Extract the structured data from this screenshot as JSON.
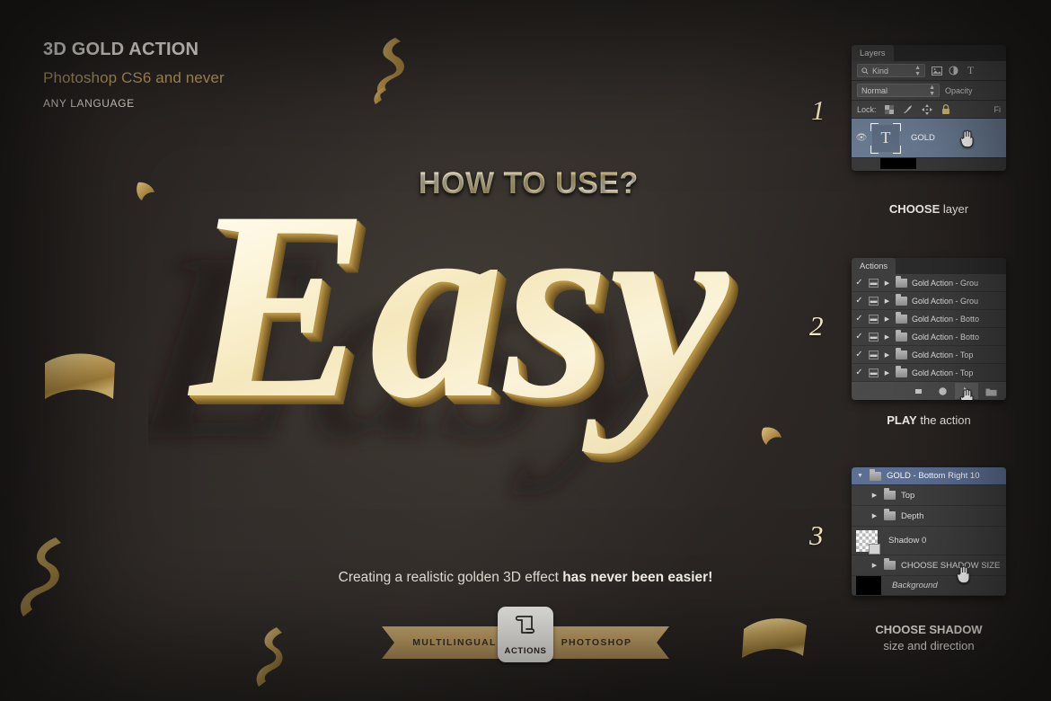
{
  "meta": {
    "background_color": "#2b2724",
    "gold_color": "#c4a469",
    "cream_color": "#f6ecc6"
  },
  "header": {
    "title": "3D GOLD ACTION",
    "subtitle": "Photoshop CS6 and never",
    "note": "ANY LANGUAGE"
  },
  "hero": {
    "howto": "HOW TO USE?",
    "word": "Easy",
    "tagline_light": "Creating a realistic golden 3D effect ",
    "tagline_bold": "has never been easier!"
  },
  "ribbon": {
    "left_label": "MULTILINGUAL",
    "right_label": "PHOTOSHOP",
    "badge_label": "ACTIONS",
    "badge_icon": "scroll-icon"
  },
  "steps": [
    {
      "number": "1",
      "caption_bold": "CHOOSE",
      "caption_light": " layer"
    },
    {
      "number": "2",
      "caption_bold": "PLAY",
      "caption_light": " the action"
    },
    {
      "number": "3",
      "caption_bold": "CHOOSE SHADOW",
      "caption_light": "size and direction"
    }
  ],
  "layers_panel": {
    "tab": "Layers",
    "filter_select": "Kind",
    "filter_icons": [
      "image-icon",
      "adjustment-icon",
      "type-icon"
    ],
    "blend_mode": "Normal",
    "opacity_label": "Opacity",
    "lock_label": "Lock:",
    "lock_icons": [
      "transparency-lock-icon",
      "brush-lock-icon",
      "move-lock-icon",
      "all-lock-icon"
    ],
    "fill_label": "Fi",
    "rows": [
      {
        "visible": true,
        "thumb": "type-thumbnail",
        "name": "GOLD",
        "selected": true
      }
    ]
  },
  "actions_panel": {
    "tab": "Actions",
    "rows": [
      {
        "checked": true,
        "name": "Gold Action - Grou"
      },
      {
        "checked": true,
        "name": "Gold Action - Grou"
      },
      {
        "checked": true,
        "name": "Gold Action - Botto"
      },
      {
        "checked": true,
        "name": "Gold Action - Botto"
      },
      {
        "checked": true,
        "name": "Gold Action - Top "
      },
      {
        "checked": true,
        "name": "Gold Action - Top "
      }
    ],
    "toolbar_buttons": [
      "stop-icon",
      "record-icon",
      "play-icon",
      "new-folder-icon"
    ],
    "active_button": "play-icon"
  },
  "layers_panel3": {
    "rows": [
      {
        "type": "group-head",
        "expanded": true,
        "name": "GOLD - Bottom Right 10",
        "selected": true
      },
      {
        "type": "group",
        "expanded": false,
        "name": "Top"
      },
      {
        "type": "group",
        "expanded": false,
        "name": "Depth"
      },
      {
        "type": "layer",
        "thumb": "transparent-thumbnail",
        "name": "Shadow 0"
      },
      {
        "type": "group",
        "expanded": false,
        "name": "CHOOSE SHADOW SIZE"
      },
      {
        "type": "background",
        "thumb": "black-thumbnail",
        "name": "Background"
      }
    ]
  }
}
